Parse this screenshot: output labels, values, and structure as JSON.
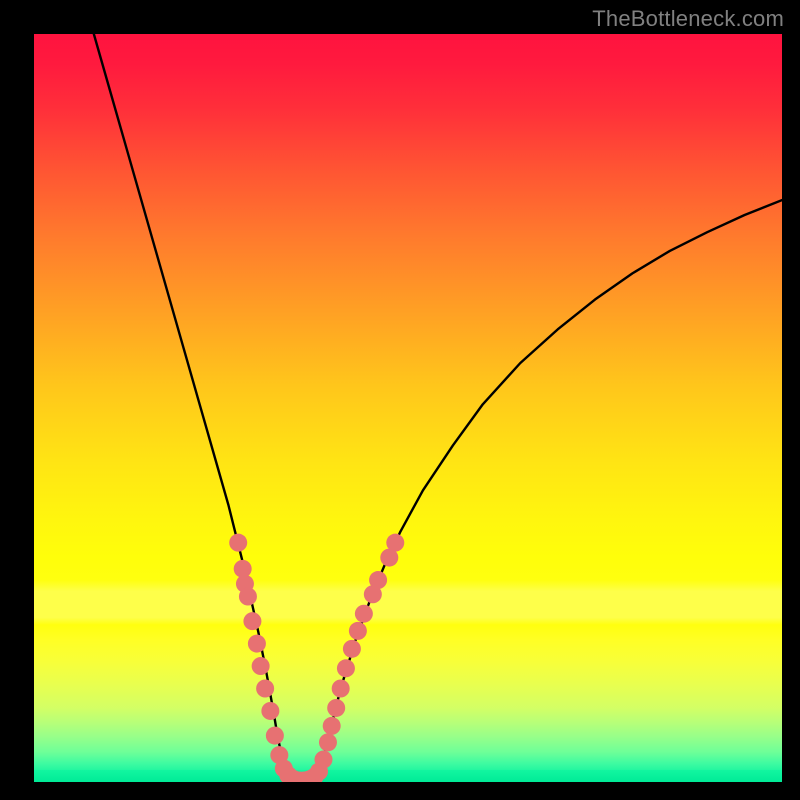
{
  "watermark": "TheBottleneck.com",
  "colors": {
    "background": "#000000",
    "curve": "#000000",
    "markers": "#e77172",
    "gradient_top": "#ff133f",
    "gradient_mid": "#fffe0a",
    "gradient_band": "#feff4a",
    "gradient_bottom": "#00ee99",
    "watermark": "#808080"
  },
  "chart_data": {
    "type": "line",
    "title": "",
    "xlabel": "",
    "ylabel": "",
    "xlim": [
      0,
      100
    ],
    "ylim": [
      0,
      100
    ],
    "series": [
      {
        "name": "bottleneck-curve",
        "x": [
          8,
          10,
          12,
          14,
          16,
          18,
          20,
          22,
          24,
          26,
          27,
          28,
          29,
          30,
          31,
          32,
          32.5,
          33,
          34,
          35,
          36,
          37,
          38,
          38.5,
          39,
          40,
          41,
          43,
          45,
          47,
          49,
          52,
          56,
          60,
          65,
          70,
          75,
          80,
          85,
          90,
          95,
          100
        ],
        "y": [
          100,
          93,
          86,
          79,
          72,
          65,
          58,
          51,
          44,
          37,
          33,
          29,
          24.5,
          20,
          15,
          9.5,
          6.5,
          4,
          1.2,
          0.3,
          0.15,
          0.3,
          1.2,
          2.6,
          4.5,
          8.5,
          12.5,
          19,
          24.5,
          29.3,
          33.5,
          39,
          45,
          50.5,
          56,
          60.5,
          64.5,
          68,
          71,
          73.5,
          75.8,
          77.8
        ]
      }
    ],
    "markers": [
      {
        "name": "left-cluster",
        "points": [
          {
            "x": 27.3,
            "y": 32
          },
          {
            "x": 27.9,
            "y": 28.5
          },
          {
            "x": 28.2,
            "y": 26.5
          },
          {
            "x": 28.6,
            "y": 24.8
          },
          {
            "x": 29.2,
            "y": 21.5
          },
          {
            "x": 29.8,
            "y": 18.5
          },
          {
            "x": 30.3,
            "y": 15.5
          },
          {
            "x": 30.9,
            "y": 12.5
          },
          {
            "x": 31.6,
            "y": 9.5
          },
          {
            "x": 32.2,
            "y": 6.2
          },
          {
            "x": 32.8,
            "y": 3.6
          },
          {
            "x": 33.4,
            "y": 1.8
          }
        ]
      },
      {
        "name": "bottom-cluster",
        "points": [
          {
            "x": 34.0,
            "y": 0.9
          },
          {
            "x": 34.7,
            "y": 0.4
          },
          {
            "x": 35.4,
            "y": 0.2
          },
          {
            "x": 36.1,
            "y": 0.2
          },
          {
            "x": 36.8,
            "y": 0.35
          },
          {
            "x": 37.5,
            "y": 0.7
          },
          {
            "x": 38.1,
            "y": 1.4
          }
        ]
      },
      {
        "name": "right-cluster",
        "points": [
          {
            "x": 38.7,
            "y": 3.0
          },
          {
            "x": 39.3,
            "y": 5.3
          },
          {
            "x": 39.8,
            "y": 7.5
          },
          {
            "x": 40.4,
            "y": 9.9
          },
          {
            "x": 41.0,
            "y": 12.5
          },
          {
            "x": 41.7,
            "y": 15.2
          },
          {
            "x": 42.5,
            "y": 17.8
          },
          {
            "x": 43.3,
            "y": 20.2
          },
          {
            "x": 44.1,
            "y": 22.5
          },
          {
            "x": 45.3,
            "y": 25.1
          },
          {
            "x": 46.0,
            "y": 27.0
          },
          {
            "x": 47.5,
            "y": 30.0
          },
          {
            "x": 48.3,
            "y": 32.0
          }
        ]
      }
    ]
  }
}
